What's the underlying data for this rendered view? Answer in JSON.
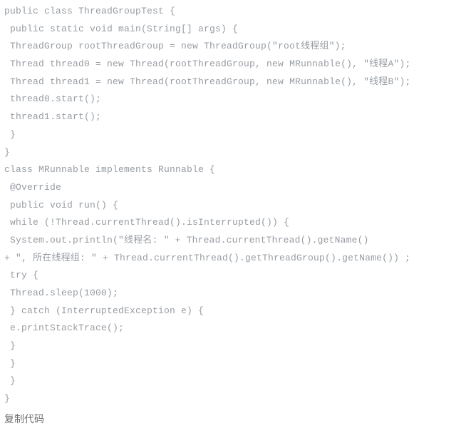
{
  "code": {
    "lines": [
      "public class ThreadGroupTest {",
      " public static void main(String[] args) {",
      " ThreadGroup rootThreadGroup = new ThreadGroup(\"root线程组\");",
      " Thread thread0 = new Thread(rootThreadGroup, new MRunnable(), \"线程A\");",
      " Thread thread1 = new Thread(rootThreadGroup, new MRunnable(), \"线程B\");",
      " thread0.start();",
      " thread1.start();",
      " }",
      "}",
      "class MRunnable implements Runnable {",
      " @Override",
      " public void run() {",
      " while (!Thread.currentThread().isInterrupted()) {",
      " System.out.println(\"线程名: \" + Thread.currentThread().getName()",
      "+ \", 所在线程组: \" + Thread.currentThread().getThreadGroup().getName()) ;",
      " try {",
      " Thread.sleep(1000);",
      " } catch (InterruptedException e) {",
      " e.printStackTrace();",
      " }",
      " }",
      " }",
      "}"
    ]
  },
  "copy_label": "复制代码"
}
